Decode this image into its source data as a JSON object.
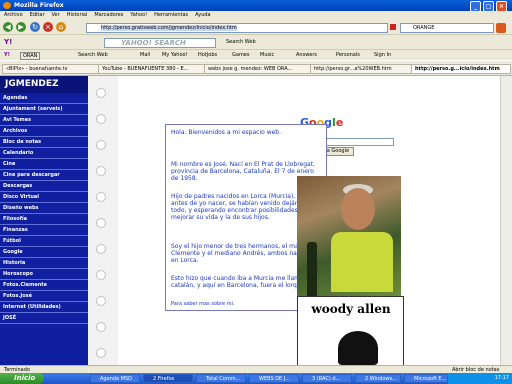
{
  "window": {
    "title": "Mozilla Firefox",
    "buttons": [
      "_",
      "□",
      "×"
    ]
  },
  "menu": [
    "Archivo",
    "Editar",
    "Ver",
    "Historial",
    "Marcadores",
    "Yahoo!",
    "Herramientas",
    "Ayuda"
  ],
  "navbar": {
    "url": "http://perso.gratisweb.com/jgmendez/Inicio/index.htm",
    "search_value": "ORANGE"
  },
  "yahoobar": {
    "logo": "Y!",
    "search_placeholder": "YAHOO! SEARCH",
    "search_web_label": "Search Web",
    "items": [
      "Mail",
      "My Yahoo!",
      "HotJobs",
      "Games",
      "Music",
      "Answers",
      "Personals",
      "Sign In"
    ]
  },
  "linksbar": {
    "items": [
      "ORAN",
      "Search Web",
      "Up",
      "Mail"
    ]
  },
  "bookmarks": [
    "«BlPlx» - buenafuente.tv",
    "YouTube - BUENAFUENTE 380 - E...",
    "webs jose g. mendez: WEB ORA...",
    "http://perso.gr...a%20WEB.htm",
    "http://perso.g...icio/index.htm"
  ],
  "sidebar": {
    "site_title": "JGMENDEZ",
    "items": [
      "Agendas",
      "Ajuntament (serveis)",
      "Avi Temes",
      "Archivos",
      "Bloc de notas",
      "Calendario",
      "Cine",
      "Cine para descargar",
      "Descargas",
      "Disco Virtual",
      "Diseño webs",
      "Filosofía",
      "Finanzas",
      "Fútbol",
      "Google",
      "Historia",
      "Horoscopo",
      "Fotos.Clemente",
      "Fotos.José",
      "Internet (Utilidades)",
      "JOSÉ"
    ]
  },
  "google": {
    "logo": "Google",
    "button_label": "Búsqueda Google"
  },
  "content": {
    "greeting": "Hola. Bienvenidos a mi espacio web.",
    "p1": "Mi nombre es José. Nací en El Prat de Llobregat, provincia de Barcelona, Cataluña. El 7 de enero de 1958.",
    "p2": "Hijo de padres nacidos en Lorca (Murcia), poco antes de yo nacer, se habían venido dejándolo todo, y esperando encontrar posibilidades de mejorar su vida y la de sus hijos.",
    "p3": "Soy el hijo menor de tres hermanos, el mayor Clemente y el mediano Andrés, ambos nacidos en Lorca.",
    "p4": "Esto hizo que cuando iba a Murcia me llamaran el catalán, y aquí en Barcelona, fuera el lorquino.",
    "p5": "Para saber mas sobre mi."
  },
  "woody": {
    "title": "woody allen"
  },
  "status": {
    "left": "Terminado",
    "right": "Abrir bloc de notas"
  },
  "taskbar": {
    "start": "Inicio",
    "tasks": [
      "Agenda MSD",
      "2 Firefox",
      "Total Comm...",
      "WEBS DE J...",
      "3 (RAC) d...",
      "2 Windows...",
      "Microsoft E..."
    ],
    "clock": "17:17"
  },
  "colors": {
    "sidebar_bg": "#0f1fa0",
    "content_text": "#1a38c2",
    "taskbar": "#1f56c8"
  }
}
